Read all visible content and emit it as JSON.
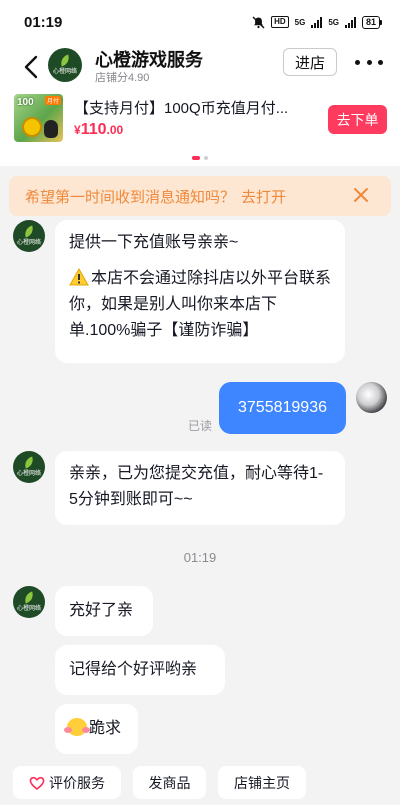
{
  "status_bar": {
    "time": "01:19",
    "hd": "HD",
    "net1": "5G",
    "net2": "5G",
    "battery": "81"
  },
  "header": {
    "shop_name": "心橙游戏服务",
    "shop_score": "店铺分4.90",
    "enter_label": "进店",
    "logo_text": "心橙网络"
  },
  "product": {
    "title": "【支持月付】100Q币充值月付...",
    "currency": "¥",
    "price_int": "110",
    "price_dec": ".00",
    "image_amount": "100",
    "image_badge": "月付",
    "buy_label": "去下单"
  },
  "notification": {
    "text": "希望第一时间收到消息通知吗？",
    "link": "去打开"
  },
  "messages": {
    "m1_line1": "提供一下充值账号亲亲~",
    "m1_warning": "本店不会通过除抖店以外平台联系你，如果是别人叫你来本店下单.100%骗子【谨防诈骗】",
    "mine_text": "3755819936",
    "read_label": "已读",
    "m2": "亲亲，已为您提交充值，耐心等待1-5分钟到账即可~~",
    "timestamp": "01:19",
    "m3": "充好了亲",
    "m4": "记得给个好评哟亲",
    "m5": "跪求"
  },
  "quick_actions": {
    "rate": "评价服务",
    "send_product": "发商品",
    "shop_home": "店铺主页"
  },
  "colors": {
    "accent": "#fe2c55",
    "mine_bubble": "#3e86ff",
    "notify_bg": "#fde6d2",
    "notify_text": "#ef8a3c"
  }
}
